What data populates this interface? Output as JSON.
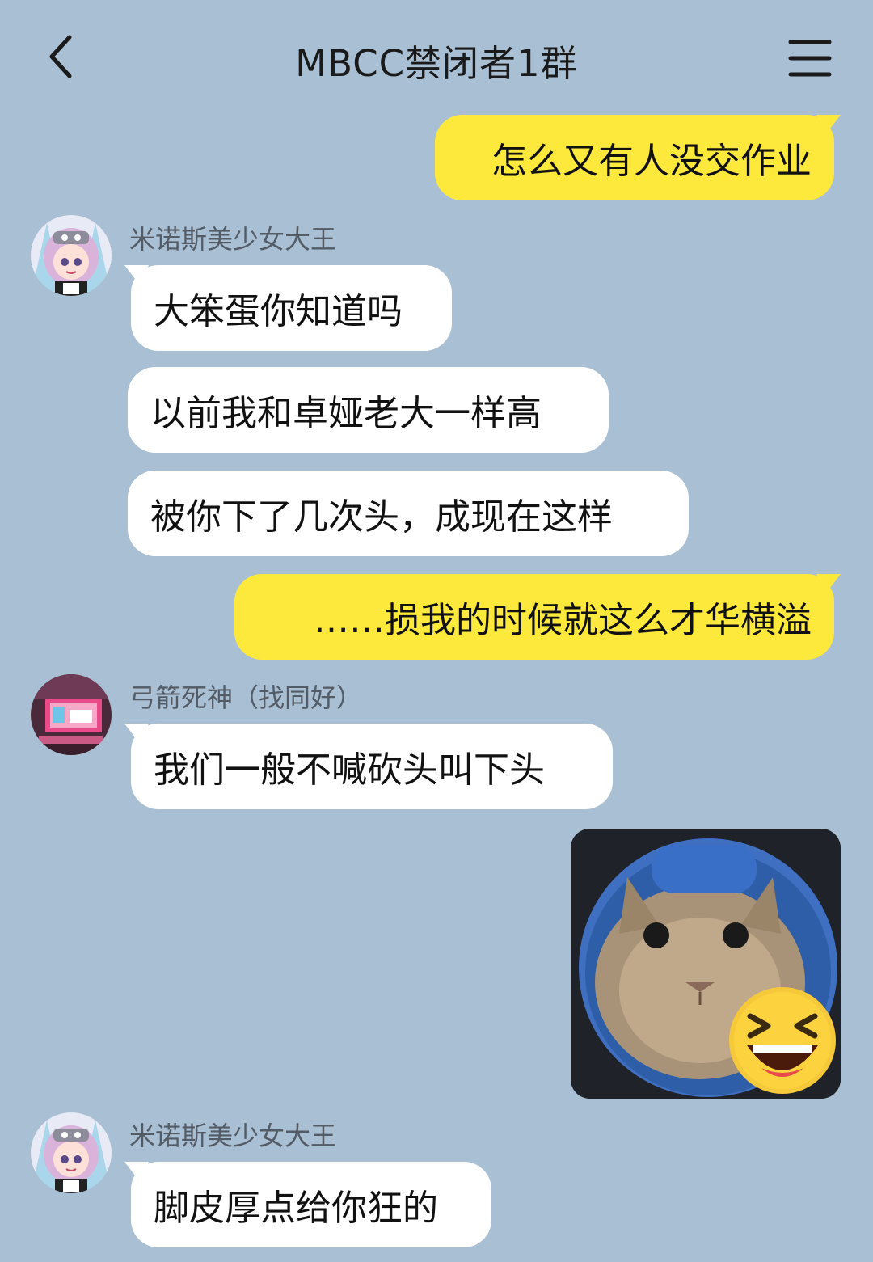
{
  "header": {
    "title": "MBCC禁闭者1群"
  },
  "messages": [
    {
      "side": "out",
      "text": "怎么又有人没交作业"
    },
    {
      "side": "in",
      "sender": "米诺斯美少女大王",
      "texts": [
        "大笨蛋你知道吗",
        "以前我和卓娅老大一样高",
        "被你下了几次头，成现在这样"
      ]
    },
    {
      "side": "out",
      "text": "……损我的时候就这么才华横溢"
    },
    {
      "side": "in",
      "sender": "弓箭死神（找同好）",
      "texts": [
        "我们一般不喊砍头叫下头"
      ]
    },
    {
      "side": "out",
      "sticker": "cat-laughing-emoji-sticker"
    },
    {
      "side": "in",
      "sender": "米诺斯美少女大王",
      "texts": [
        "脚皮厚点给你狂的"
      ]
    }
  ],
  "colors": {
    "background": "#a9bfd3",
    "outgoing_bubble": "#fde93c",
    "incoming_bubble": "#ffffff"
  }
}
